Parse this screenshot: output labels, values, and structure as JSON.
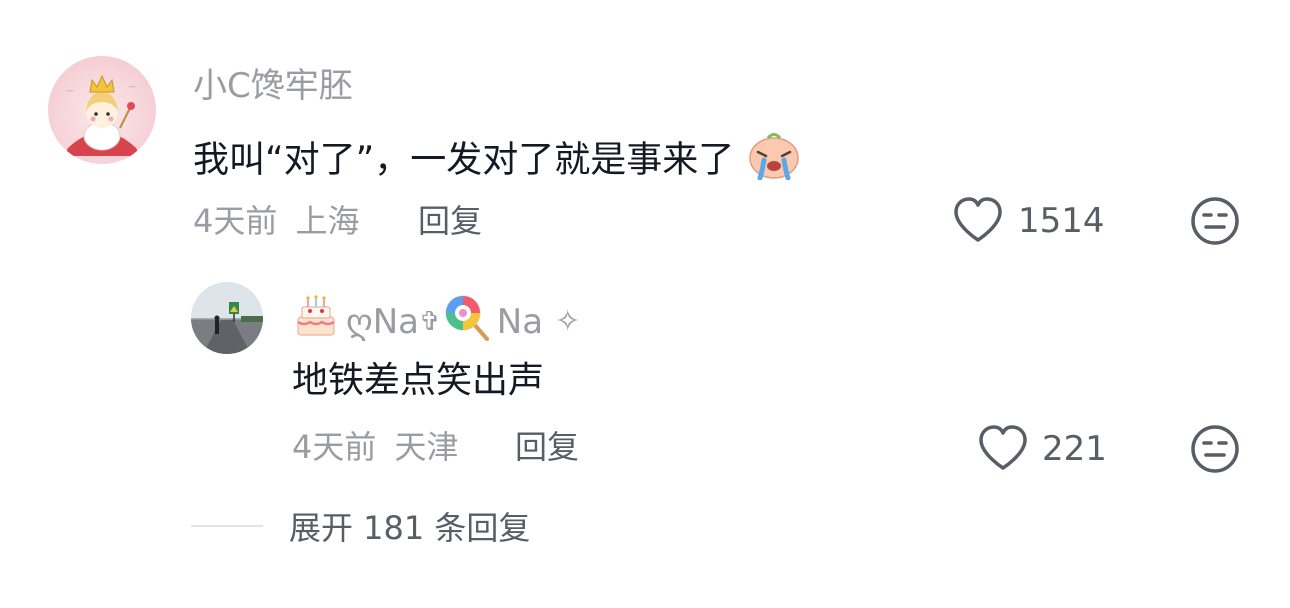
{
  "comment": {
    "username": "小C馋牢胚",
    "text": "我叫“对了”，一发对了就是事来了",
    "emoji_icon": "crying-face-icon",
    "time": "4天前",
    "location": "上海",
    "reply_label": "回复",
    "likes": "1514"
  },
  "reply": {
    "username_part1": "ღNa",
    "username_cross": "✞",
    "username_part2": "Na",
    "username_star": "✧",
    "prefix_icon": "birthday-cake-icon",
    "middle_icon": "lollipop-icon",
    "text": "地铁差点笑出声",
    "time": "4天前",
    "location": "天津",
    "reply_label": "回复",
    "likes": "221"
  },
  "expand": {
    "label": "展开 181 条回复"
  },
  "colors": {
    "secondary_text": "#9b9ca3",
    "primary_text": "#161823",
    "action_text": "#5a5c66"
  }
}
